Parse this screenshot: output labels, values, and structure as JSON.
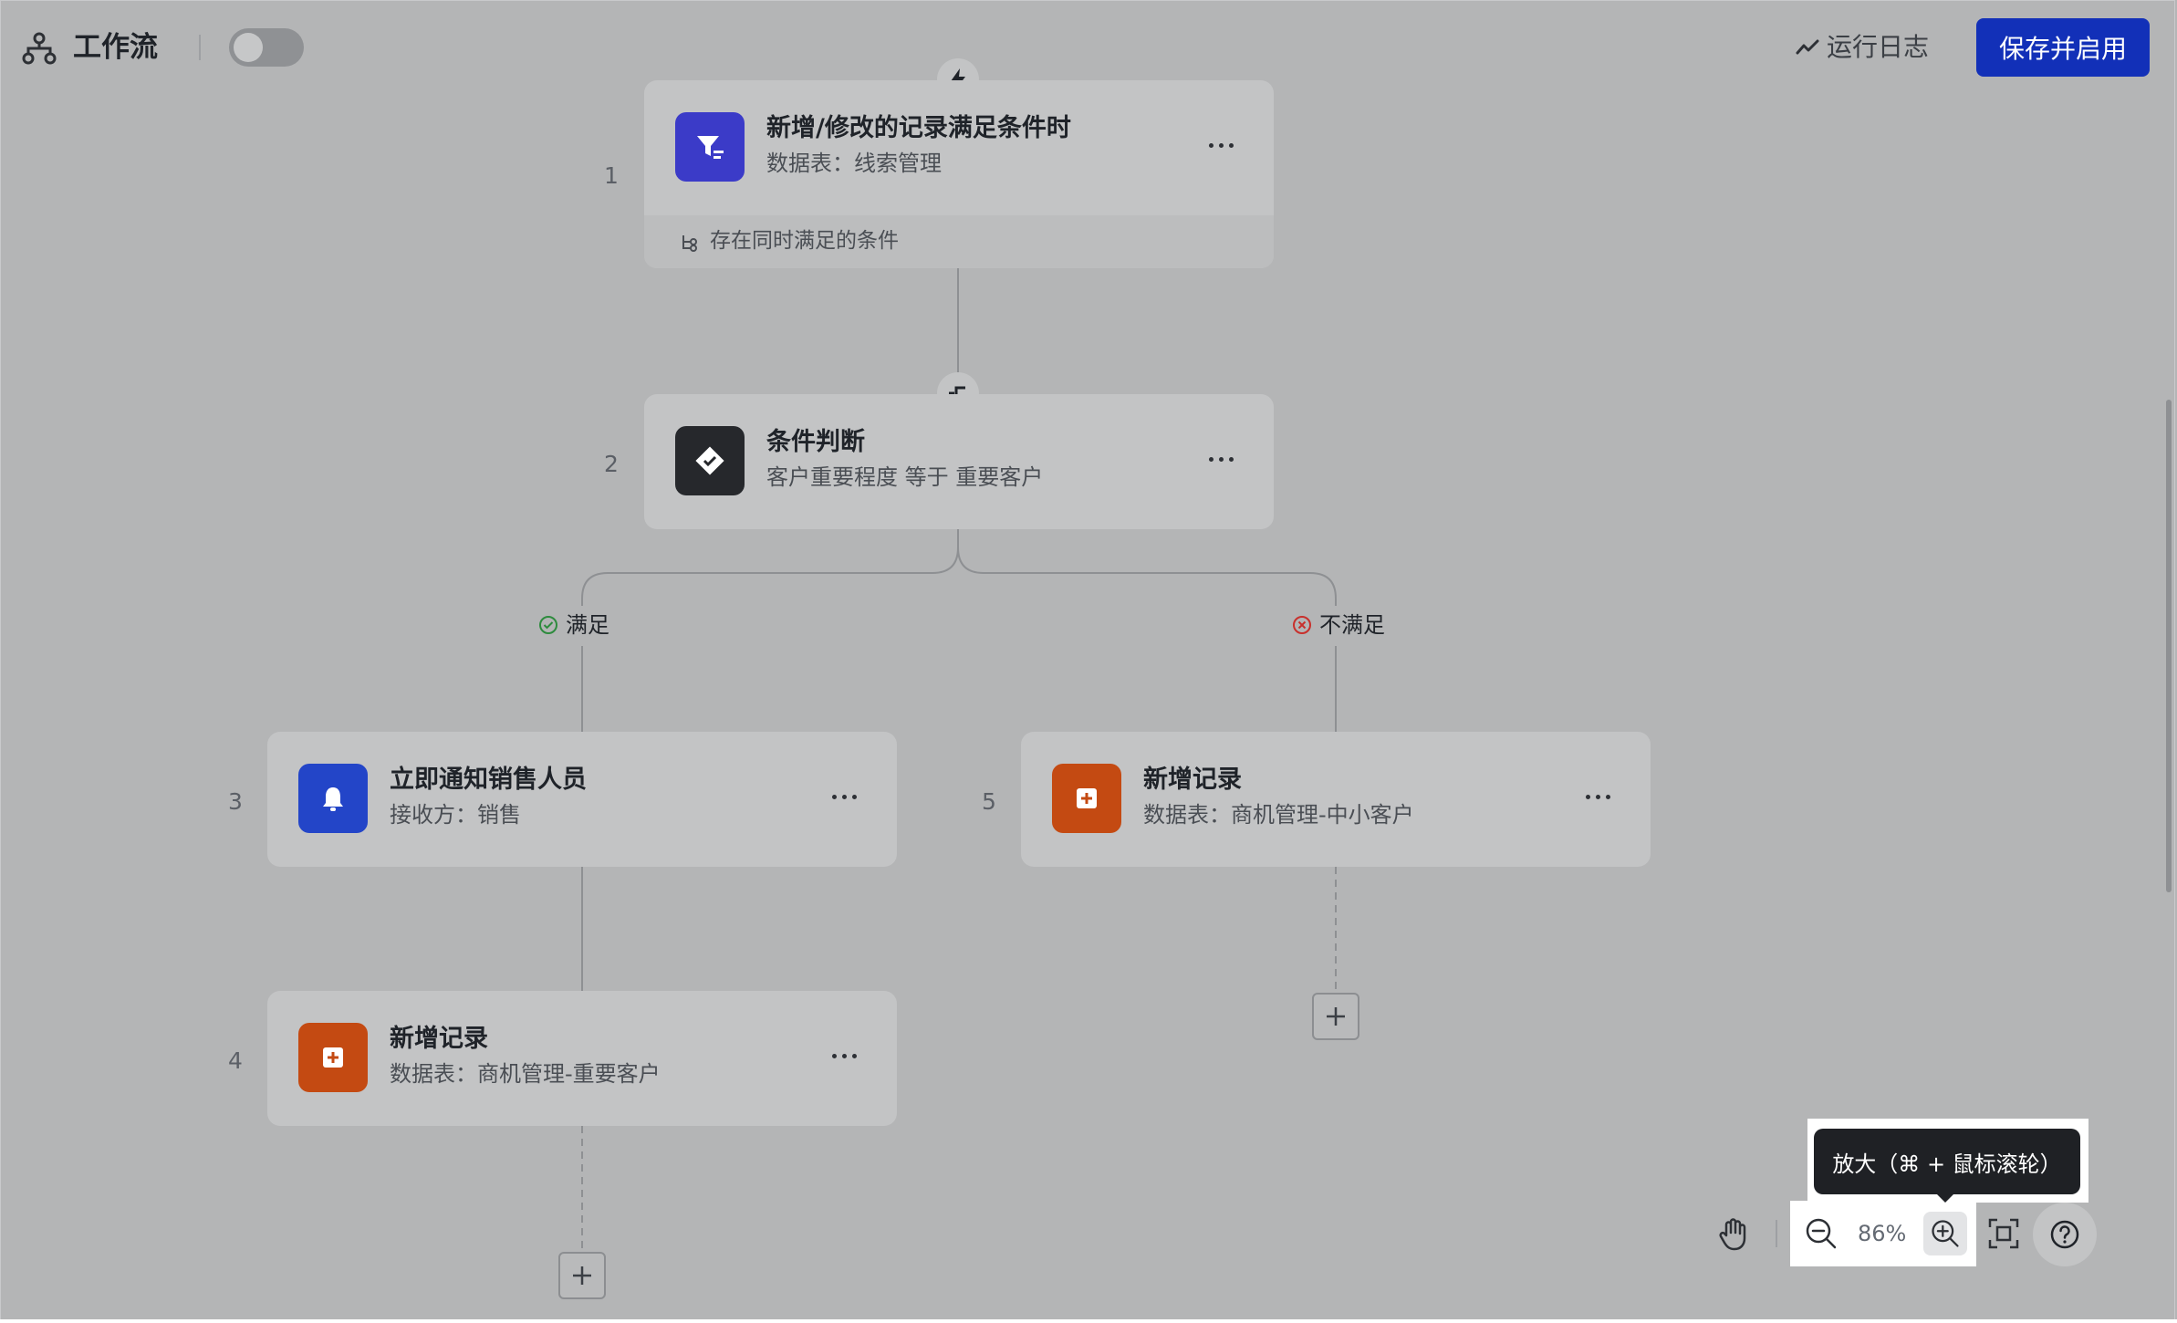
{
  "header": {
    "title": "工作流",
    "run_log_label": "运行日志",
    "save_button_label": "保存并启用",
    "toggle_on": false
  },
  "nodes": [
    {
      "step": "1",
      "title": "新增/修改的记录满足条件时",
      "subtitle": "数据表：线索管理",
      "footer": "存在同时满足的条件",
      "icon": "filter-icon",
      "icon_color": "#3b3bc8"
    },
    {
      "step": "2",
      "title": "条件判断",
      "subtitle": "客户重要程度 等于 重要客户",
      "icon": "check-diamond-icon",
      "icon_color": "#26282c"
    },
    {
      "step": "3",
      "title": "立即通知销售人员",
      "subtitle": "接收方：销售",
      "icon": "bell-icon",
      "icon_color": "#2345c8"
    },
    {
      "step": "4",
      "title": "新增记录",
      "subtitle": "数据表：商机管理-重要客户",
      "icon": "add-record-icon",
      "icon_color": "#c44a12"
    },
    {
      "step": "5",
      "title": "新增记录",
      "subtitle": "数据表：商机管理-中小客户",
      "icon": "add-record-icon",
      "icon_color": "#c44a12"
    }
  ],
  "branches": {
    "yes_label": "满足",
    "no_label": "不满足"
  },
  "zoom": {
    "value": "86%",
    "tooltip": "放大（⌘ + 鼠标滚轮）"
  }
}
